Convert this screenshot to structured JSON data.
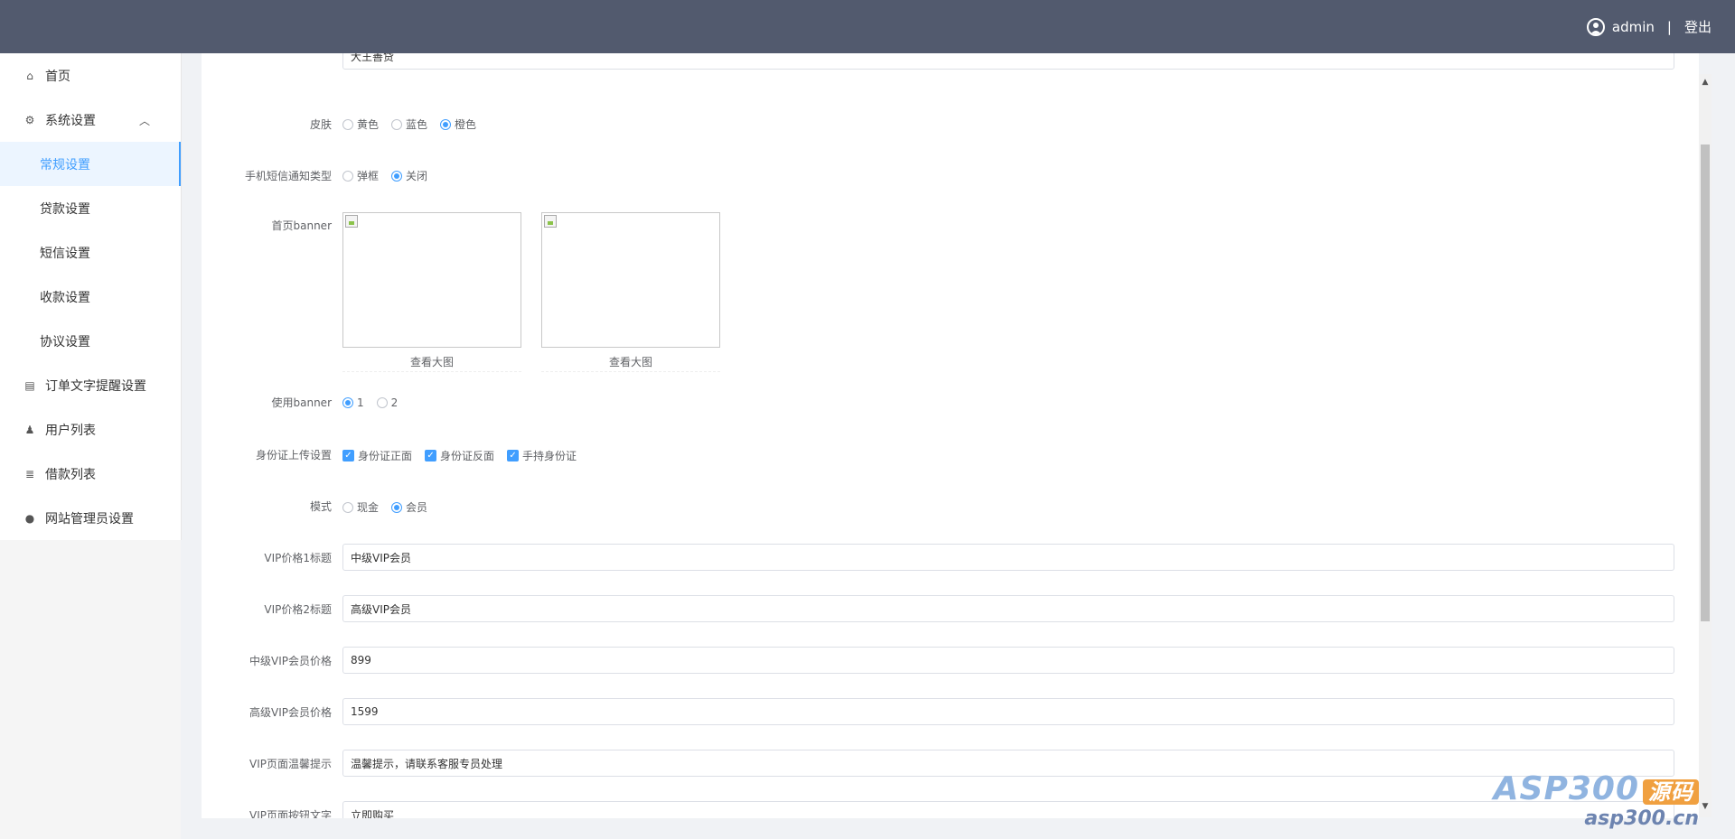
{
  "header": {
    "username": "admin",
    "separator": "|",
    "logout_label": "登出"
  },
  "sidebar": {
    "items": [
      {
        "label": "首页",
        "icon": "home-icon"
      },
      {
        "label": "系统设置",
        "icon": "gear-icon",
        "expanded": true
      },
      {
        "label": "常规设置",
        "sub": true,
        "active": true
      },
      {
        "label": "贷款设置",
        "sub": true
      },
      {
        "label": "短信设置",
        "sub": true
      },
      {
        "label": "收款设置",
        "sub": true
      },
      {
        "label": "协议设置",
        "sub": true
      },
      {
        "label": "订单文字提醒设置",
        "icon": "list-icon"
      },
      {
        "label": "用户列表",
        "icon": "users-icon"
      },
      {
        "label": "借款列表",
        "icon": "doc-list-icon"
      },
      {
        "label": "网站管理员设置",
        "icon": "user-icon"
      }
    ]
  },
  "form": {
    "top_field": {
      "value": "大王善贷"
    },
    "skin": {
      "label": "皮肤",
      "options": [
        "黄色",
        "蓝色",
        "橙色"
      ],
      "selected": "橙色"
    },
    "sms_type": {
      "label": "手机短信通知类型",
      "options": [
        "弹框",
        "关闭"
      ],
      "selected": "关闭"
    },
    "banner": {
      "label": "首页banner",
      "view_label": "查看大图"
    },
    "use_banner": {
      "label": "使用banner",
      "options": [
        "1",
        "2"
      ],
      "selected": "1"
    },
    "id_upload": {
      "label": "身份证上传设置",
      "options": [
        "身份证正面",
        "身份证反面",
        "手持身份证"
      ]
    },
    "mode": {
      "label": "模式",
      "options": [
        "现金",
        "会员"
      ],
      "selected": "会员"
    },
    "vip1_title": {
      "label": "VIP价格1标题",
      "value": "中级VIP会员"
    },
    "vip2_title": {
      "label": "VIP价格2标题",
      "value": "高级VIP会员"
    },
    "mid_price": {
      "label": "中级VIP会员价格",
      "value": "899"
    },
    "high_price": {
      "label": "高级VIP会员价格",
      "value": "1599"
    },
    "vip_tip": {
      "label": "VIP页面温馨提示",
      "value": "温馨提示，请联系客服专员处理"
    },
    "vip_btn": {
      "label": "VIP页面按钮文字",
      "value": "立即购买"
    }
  },
  "watermark": {
    "line1": "ASP300",
    "tag": "源码",
    "line2": "asp300.cn"
  }
}
